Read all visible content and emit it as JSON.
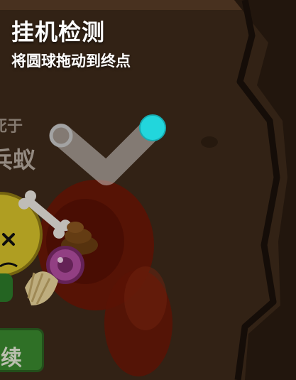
{
  "header": {
    "title": "挂机检测",
    "subtitle": "将圆球拖动到终点"
  },
  "background": {
    "death_text": "死于",
    "killer_text": "兵蚁",
    "continue_label": "续"
  },
  "puzzle": {
    "ball_color": "#22d6dc",
    "target_color": "#9a9a9a",
    "path_color": "#e6e6e6"
  },
  "colors": {
    "ground": "#3a2718",
    "wall": "#22160e",
    "blood": "#7a1a08",
    "button_green": "#2f8a2c"
  },
  "icons": [
    "dead-ant-icon",
    "bone-icon",
    "poop-icon",
    "candy-icon",
    "shell-icon"
  ]
}
